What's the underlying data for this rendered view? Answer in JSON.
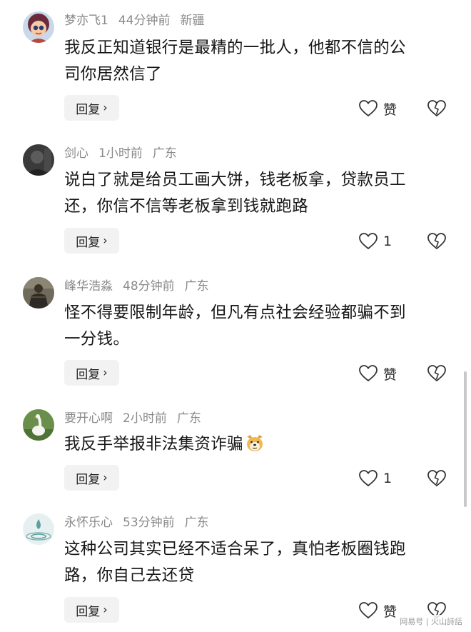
{
  "comments": [
    {
      "username": "梦亦飞1",
      "time": "44分钟前",
      "location": "新疆",
      "text_lines": [
        "我反正知道银行是最精的一批人，他都不信的公",
        "司你居然信了"
      ],
      "reply_label": "回复",
      "like_label": "赞",
      "avatar": "cartoon-girl-avatar"
    },
    {
      "username": "剑心",
      "time": "1小时前",
      "location": "广东",
      "text_lines": [
        "说白了就是给员工画大饼，钱老板拿，贷款员工",
        "还，你信不信等老板拿到钱就跑路"
      ],
      "reply_label": "回复",
      "like_label": "1",
      "avatar": "dark-portrait-avatar"
    },
    {
      "username": "峰华浩淼",
      "time": "48分钟前",
      "location": "广东",
      "text_lines": [
        "怪不得要限制年龄，但凡有点社会经验都骗不到",
        "一分钱。"
      ],
      "reply_label": "回复",
      "like_label": "赞",
      "avatar": "warrior-avatar"
    },
    {
      "username": "要开心啊",
      "time": "2小时前",
      "location": "广东",
      "text_lines": [
        "我反手举报非法集资诈骗"
      ],
      "reply_label": "回复",
      "like_label": "1",
      "avatar": "goose-avatar",
      "emoji": "doge-emoji"
    },
    {
      "username": "永怀乐心",
      "time": "53分钟前",
      "location": "广东",
      "text_lines": [
        "这种公司其实已经不适合呆了，真怕老板圈钱跑",
        "路，你自己去还贷"
      ],
      "reply_label": "回复",
      "like_label": "赞",
      "avatar": "water-drop-avatar"
    }
  ],
  "watermark": "网易号 | 火山詩話",
  "colors": {
    "meta": "#8a8a8a",
    "text": "#161616",
    "reply_bg": "#f2f2f2"
  }
}
